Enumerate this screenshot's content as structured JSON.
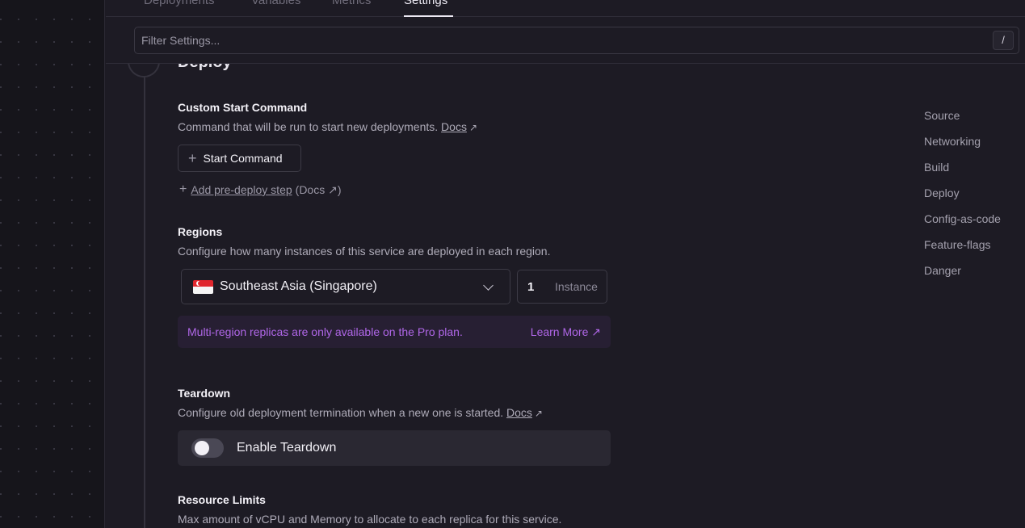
{
  "tabs": [
    {
      "label": "Deployments"
    },
    {
      "label": "Variables"
    },
    {
      "label": "Metrics"
    },
    {
      "label": "Settings",
      "active": true
    }
  ],
  "filter": {
    "placeholder": "Filter Settings...",
    "shortcut": "/"
  },
  "section": {
    "title": "Deploy"
  },
  "start_command": {
    "heading": "Custom Start Command",
    "description": "Command that will be run to start new deployments.",
    "docs_label": "Docs",
    "button_label": "Start Command",
    "predeploy_label": "Add pre-deploy step",
    "predeploy_docs": "(Docs ↗)"
  },
  "regions": {
    "heading": "Regions",
    "description": "Configure how many instances of this service are deployed in each region.",
    "selected_region": "Southeast Asia (Singapore)",
    "instance_count": "1",
    "instance_label": "Instance",
    "pro_notice": "Multi-region replicas are only available on the Pro plan.",
    "learn_more_label": "Learn More ↗"
  },
  "teardown": {
    "heading": "Teardown",
    "description": "Configure old deployment termination when a new one is started.",
    "docs_label": "Docs",
    "toggle_label": "Enable Teardown",
    "enabled": false
  },
  "resource_limits": {
    "heading": "Resource Limits",
    "description": "Max amount of vCPU and Memory to allocate to each replica for this service."
  },
  "side_nav": {
    "items": [
      "Source",
      "Networking",
      "Build",
      "Deploy",
      "Config-as-code",
      "Feature-flags",
      "Danger"
    ]
  },
  "icons": {
    "arrow": "↗",
    "plus": "+"
  },
  "colors": {
    "accent_purple": "#b067e8",
    "background": "#1d1b24"
  }
}
